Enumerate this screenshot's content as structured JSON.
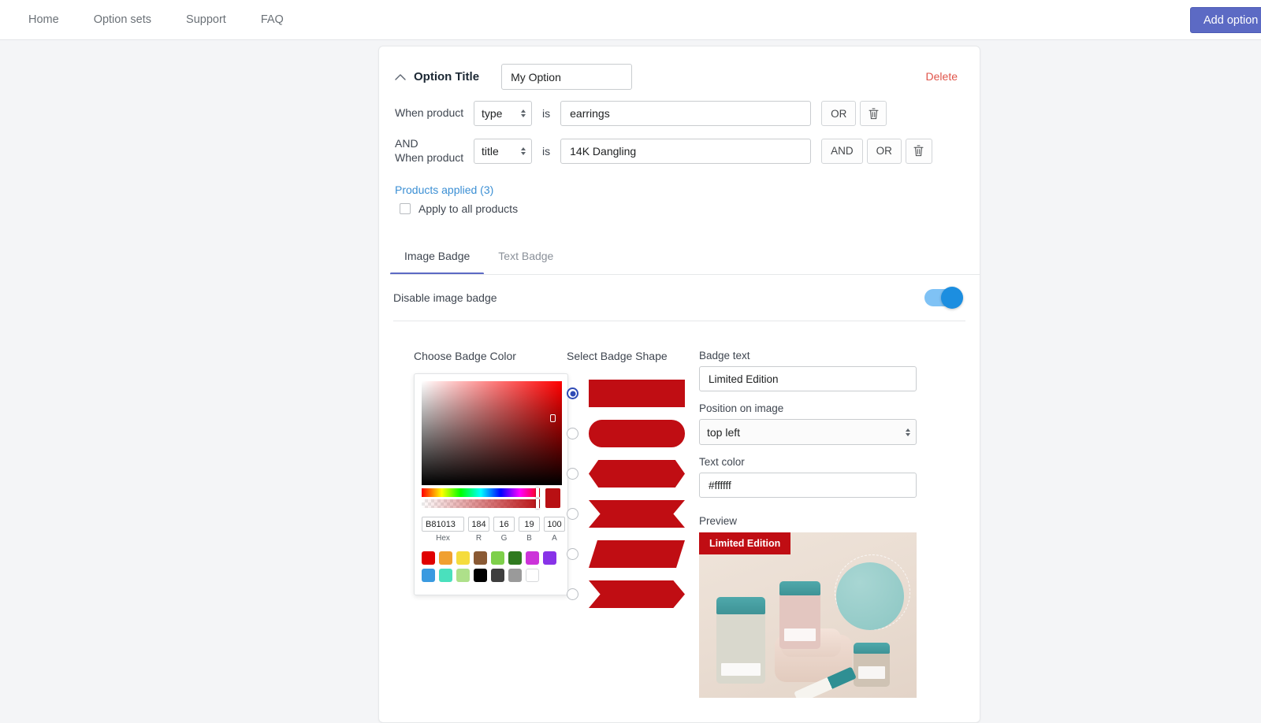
{
  "nav": {
    "items": [
      {
        "label": "Home"
      },
      {
        "label": "Option sets"
      },
      {
        "label": "Support"
      },
      {
        "label": "FAQ"
      }
    ],
    "add_option_label": "Add option",
    "add_option_color": "#5c6ac4"
  },
  "option_card": {
    "collapse_icon": "chevron-up-icon",
    "title_label": "Option Title",
    "title_value": "My Option",
    "delete_label": "Delete",
    "conditions": [
      {
        "prefix": "",
        "when_label": "When product",
        "field": "type",
        "is_word": "is",
        "value": "earrings",
        "buttons": [
          "OR"
        ],
        "has_delete": true
      },
      {
        "prefix": "AND",
        "when_label": "When product",
        "field": "title",
        "is_word": "is",
        "value": "14K Dangling",
        "buttons": [
          "AND",
          "OR"
        ],
        "has_delete": true
      }
    ],
    "products_applied_label": "Products applied (3)",
    "apply_all_label": "Apply to all products",
    "apply_all_checked": false
  },
  "tabs": [
    {
      "label": "Image Badge",
      "active": true
    },
    {
      "label": "Text Badge",
      "active": false
    }
  ],
  "toggle": {
    "label": "Disable image badge",
    "on": true,
    "on_color": "#1c8ee0"
  },
  "color_picker": {
    "heading": "Choose Badge Color",
    "current_color": "#b81013",
    "hex_value": "B81013",
    "r_value": "184",
    "g_value": "16",
    "b_value": "19",
    "a_value": "100",
    "hex_label": "Hex",
    "r_label": "R",
    "g_label": "G",
    "b_label": "B",
    "a_label": "A",
    "swatches_row1": [
      "#e00000",
      "#f0a030",
      "#f5dc3c",
      "#8a5a34",
      "#7ed04a",
      "#2f7a1f",
      "#cc33d9",
      "#8833e8"
    ],
    "swatches_row2": [
      "#3a9ae0",
      "#4ae0bd",
      "#aee08a",
      "#000000",
      "#3e3e3e",
      "#9a9a9a",
      "#ffffff"
    ]
  },
  "badge_shape": {
    "heading": "Select Badge Shape",
    "color": "#c00d13",
    "selected_index": 0,
    "shapes": [
      {
        "name": "rectangle"
      },
      {
        "name": "rounded"
      },
      {
        "name": "hexagon"
      },
      {
        "name": "ribbon"
      },
      {
        "name": "parallelogram"
      },
      {
        "name": "arrow"
      }
    ]
  },
  "badge_settings": {
    "badge_text_label": "Badge text",
    "badge_text_value": "Limited Edition",
    "position_label": "Position on image",
    "position_value": "top left",
    "text_color_label": "Text color",
    "text_color_value": "#ffffff",
    "preview_label": "Preview",
    "preview_badge_text": "Limited Edition"
  }
}
